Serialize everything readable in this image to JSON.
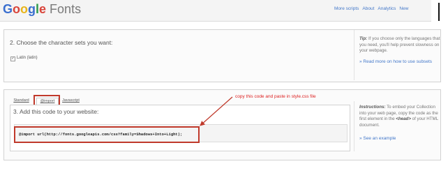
{
  "header": {
    "logo": {
      "g1": "G",
      "g2": "o",
      "g3": "o",
      "g4": "g",
      "g5": "l",
      "g6": "e",
      "fonts": "Fonts"
    },
    "nav": [
      "More scripts",
      "About",
      "Analytics",
      "New"
    ]
  },
  "section2": {
    "title": "2. Choose the character sets you want:",
    "checkbox": {
      "label": "Latin (latin)",
      "checked": true,
      "mark": "✓"
    },
    "tip": {
      "lead": "Tip:",
      "body": " If you choose only the languages that you need, you'll help prevent slowness on your webpage."
    },
    "link": "» Read more on how to use subsets"
  },
  "section3": {
    "tabs": [
      "Standard",
      "@import",
      "Javascript"
    ],
    "active_tab": "@import",
    "title": "3. Add this code to your website:",
    "code": "@import url(http://fonts.googleapis.com/css?family=Shadows+Into+Light);",
    "annotation": "copy this code and paste  in style.css file",
    "instructions": {
      "lead": "Instructions:",
      "part1": " To embed your Collection into your web page, copy the code as the first element in the ",
      "tag": "<head>",
      "part2": " of your HTML document."
    },
    "link": "» See an example"
  },
  "colors": {
    "link": "#4277c9",
    "annotation_red": "#c0392b",
    "logo_blue": "#3a6fcf",
    "logo_red": "#d9443a",
    "logo_yellow": "#e8b51b",
    "logo_green": "#2f9b4d"
  }
}
